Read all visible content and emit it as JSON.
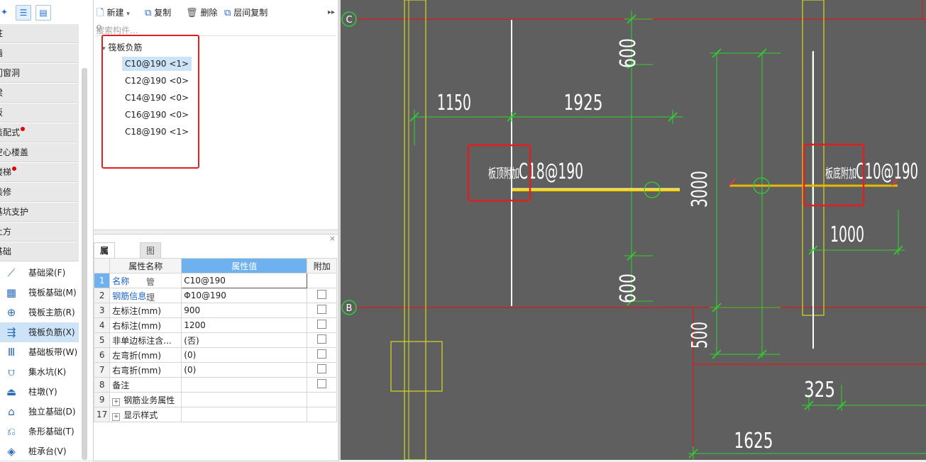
{
  "nav_toolbar": {
    "icons": [
      "new-star-icon",
      "list-view-icon",
      "detail-view-icon"
    ]
  },
  "nav": {
    "categories": [
      {
        "label": "柱",
        "dot": false
      },
      {
        "label": "墙",
        "dot": false
      },
      {
        "label": "门窗洞",
        "dot": false
      },
      {
        "label": "梁",
        "dot": false
      },
      {
        "label": "板",
        "dot": false
      },
      {
        "label": "装配式",
        "dot": true
      },
      {
        "label": "空心楼盖",
        "dot": false
      },
      {
        "label": "楼梯",
        "dot": true
      },
      {
        "label": "装修",
        "dot": false
      },
      {
        "label": "基坑支护",
        "dot": false
      },
      {
        "label": "土方",
        "dot": false
      },
      {
        "label": "基础",
        "dot": false
      }
    ],
    "items": [
      {
        "label": "基础梁(F)",
        "icon": "foundation-beam-icon"
      },
      {
        "label": "筏板基础(M)",
        "icon": "raft-foundation-icon"
      },
      {
        "label": "筏板主筋(R)",
        "icon": "raft-main-rebar-icon"
      },
      {
        "label": "筏板负筋(X)",
        "icon": "raft-negative-rebar-icon",
        "active": true
      },
      {
        "label": "基础板带(W)",
        "icon": "foundation-strip-icon"
      },
      {
        "label": "集水坑(K)",
        "icon": "sump-pit-icon"
      },
      {
        "label": "柱墩(Y)",
        "icon": "column-pier-icon"
      },
      {
        "label": "独立基础(D)",
        "icon": "isolated-footing-icon"
      },
      {
        "label": "条形基础(T)",
        "icon": "strip-footing-icon"
      },
      {
        "label": "桩承台(V)",
        "icon": "pile-cap-icon"
      }
    ]
  },
  "toolbar": {
    "new_label": "新建",
    "copy_label": "复制",
    "delete_label": "删除",
    "floor_copy_label": "层间复制"
  },
  "search": {
    "placeholder": "搜索构件..."
  },
  "tree": {
    "root_label": "筏板负筋",
    "items": [
      "C10@190 <1>",
      "C12@190 <0>",
      "C14@190 <0>",
      "C16@190 <0>",
      "C18@190 <1>"
    ]
  },
  "props": {
    "tabs": [
      "属性列表",
      "图层管理"
    ],
    "headers": {
      "name": "属性名称",
      "value": "属性值",
      "extra": "附加"
    },
    "rows": [
      {
        "n": "1",
        "name": "名称",
        "value": "C10@190",
        "blue": true,
        "check": false,
        "sel": true
      },
      {
        "n": "2",
        "name": "钢筋信息",
        "value": "Φ10@190",
        "blue": true,
        "check": true
      },
      {
        "n": "3",
        "name": "左标注(mm)",
        "value": "900",
        "check": true
      },
      {
        "n": "4",
        "name": "右标注(mm)",
        "value": "1200",
        "check": true
      },
      {
        "n": "5",
        "name": "非单边标注含...",
        "value": "(否)",
        "check": true
      },
      {
        "n": "6",
        "name": "左弯折(mm)",
        "value": "(0)",
        "check": true
      },
      {
        "n": "7",
        "name": "右弯折(mm)",
        "value": "(0)",
        "check": true
      },
      {
        "n": "8",
        "name": "备注",
        "value": "",
        "check": true
      },
      {
        "n": "9",
        "name": "钢筋业务属性",
        "value": "",
        "expand": true
      },
      {
        "n": "17",
        "name": "显示样式",
        "value": "",
        "expand": true
      }
    ]
  },
  "cad": {
    "axis_c": "C",
    "axis_b": "B",
    "dims": {
      "d600a": "600",
      "d1150": "1150",
      "d1925": "1925",
      "d3000": "3000",
      "d600b": "600",
      "d500": "500",
      "d1000": "1000",
      "d325": "325",
      "d1625": "1625"
    },
    "label_left": {
      "text": "板顶附加",
      "spec": "C18@190"
    },
    "label_right": {
      "text": "板底附加",
      "spec": "C10@190"
    }
  }
}
